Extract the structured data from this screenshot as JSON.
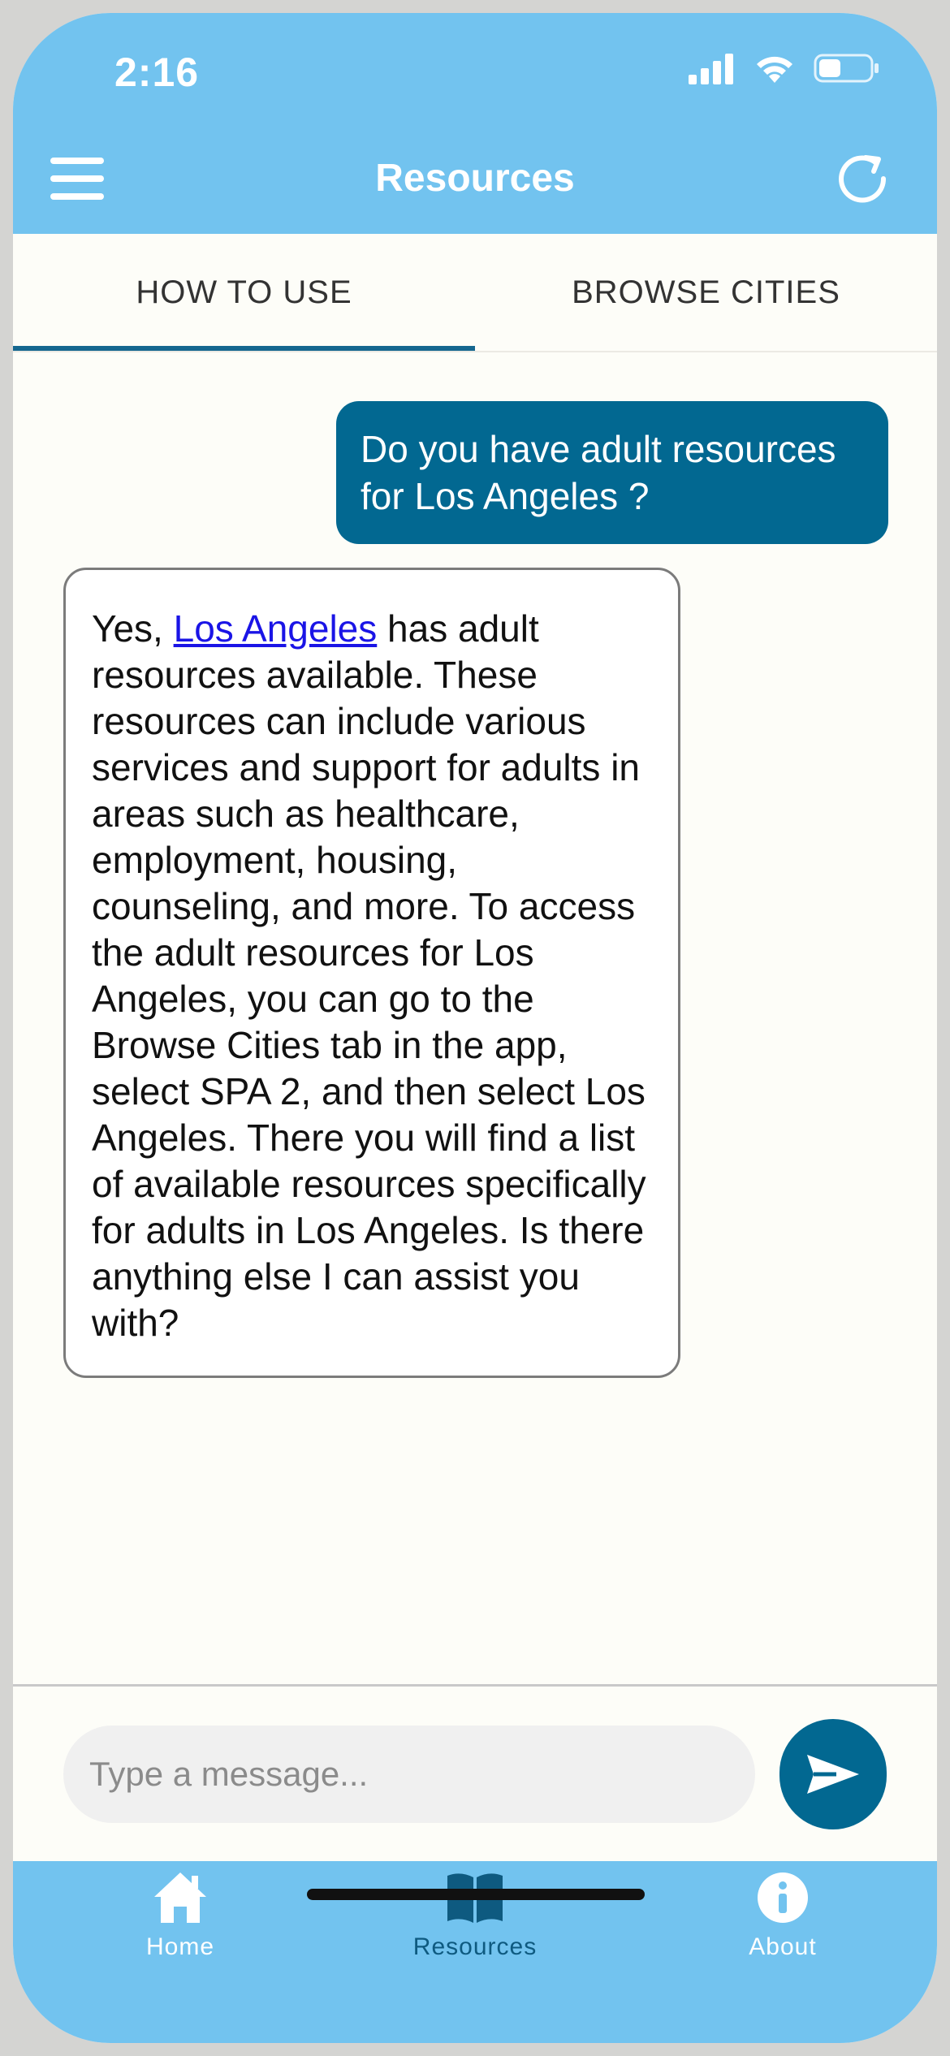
{
  "status_bar": {
    "time": "2:16"
  },
  "header": {
    "title": "Resources"
  },
  "tabs": [
    {
      "label": "HOW TO USE",
      "active": true
    },
    {
      "label": "BROWSE CITIES",
      "active": false
    }
  ],
  "messages": {
    "user": "Do you have adult resources for Los Angeles ?",
    "bot": {
      "prefix": "Yes, ",
      "link_text": "Los Angeles",
      "suffix": " has adult resources available. These resources can include various services and support for adults in areas such as healthcare, employment, housing, counseling, and more. To access the adult resources for Los Angeles, you can go to the Browse Cities tab in the app, select SPA 2, and then select Los Angeles. There you will find a list of available resources specifically for adults in Los Angeles. Is there anything else I can assist you with?"
    }
  },
  "composer": {
    "placeholder": "Type a message...",
    "value": ""
  },
  "bottom_nav": [
    {
      "label": "Home",
      "icon": "home-icon"
    },
    {
      "label": "Resources",
      "icon": "book-icon",
      "active": true
    },
    {
      "label": "About",
      "icon": "info-icon"
    }
  ],
  "colors": {
    "header": "#72c3ef",
    "accent": "#026891",
    "link": "#1a14e6",
    "active_nav": "#0e5a80"
  }
}
